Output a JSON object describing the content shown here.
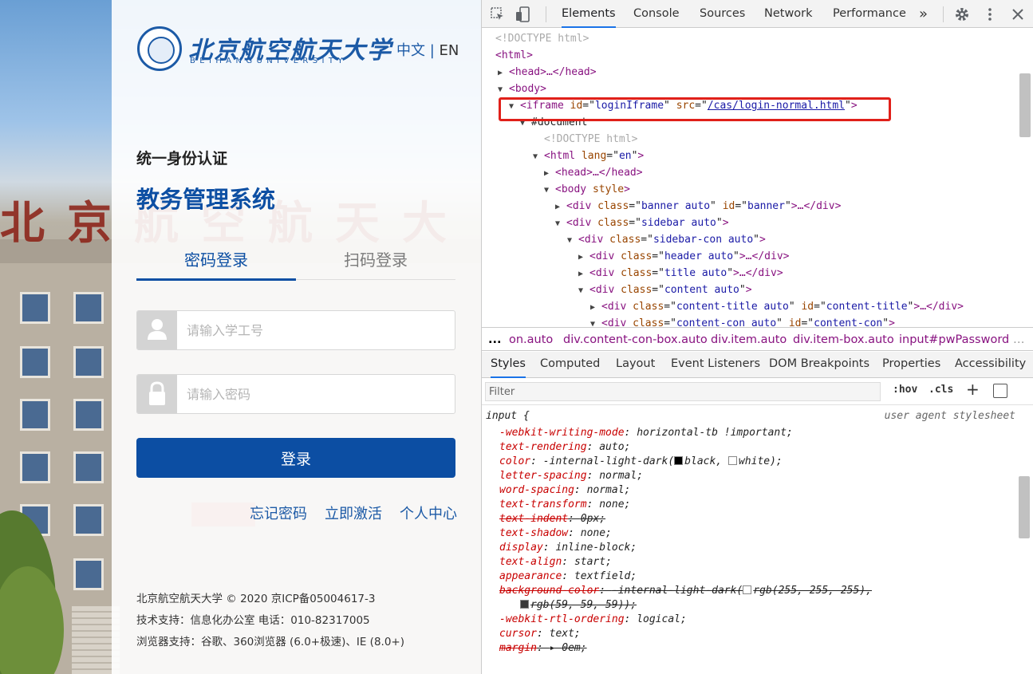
{
  "login": {
    "logo_cn": "北京航空航天大学",
    "logo_en": "BEIHANGUNIVERSITY",
    "lang_cn": "中文",
    "lang_sep": "|",
    "lang_en": "EN",
    "subtitle": "统一身份认证",
    "system_title": "教务管理系统",
    "tabs": [
      "密码登录",
      "扫码登录"
    ],
    "username_placeholder": "请输入学工号",
    "password_placeholder": "请输入密码",
    "login_button": "登录",
    "links": [
      "忘记密码",
      "立即激活",
      "个人中心"
    ],
    "footer": [
      "北京航空航天大学 © 2020 京ICP备05004617-3",
      "技术支持：信息化办公室 电话：010-82317005",
      "浏览器支持：谷歌、360浏览器 (6.0+极速)、IE (8.0+)"
    ],
    "background_sign": "北京航空航天大"
  },
  "devtools": {
    "tabs": [
      "Elements",
      "Console",
      "Sources",
      "Network",
      "Performance",
      "»"
    ],
    "dom": {
      "doctype1": "<!DOCTYPE html>",
      "html_open": "<html>",
      "head_collapsed": "<head>…</head>",
      "body_open": "<body>",
      "iframe": {
        "tag": "iframe",
        "id_attr": "id",
        "id_val": "loginIframe",
        "src_attr": "src",
        "src_val": "/cas/login-normal.html"
      },
      "document": "#document",
      "doctype2": "<!DOCTYPE html>",
      "html_lang": {
        "tag": "html",
        "attr": "lang",
        "val": "en"
      },
      "head2": "<head>…</head>",
      "body_style": {
        "tag": "body",
        "attr": "style"
      },
      "banner": {
        "tag": "div",
        "class": "banner auto",
        "id": "banner"
      },
      "sidebar": {
        "tag": "div",
        "class": "sidebar auto"
      },
      "sidebar_con": {
        "tag": "div",
        "class": "sidebar-con auto"
      },
      "header": {
        "tag": "div",
        "class": "header auto"
      },
      "title": {
        "tag": "div",
        "class": "title auto"
      },
      "content": {
        "tag": "div",
        "class": "content auto"
      },
      "content_title": {
        "tag": "div",
        "class": "content-title auto",
        "id": "content-title"
      },
      "content_con": {
        "tag": "div",
        "class": "content-con auto",
        "id": "content-con"
      }
    },
    "breadcrumbs": [
      "...",
      "on.auto",
      "div.content-con-box.auto",
      "div.item.auto",
      "div.item-box.auto",
      "input#pwPassword",
      "…"
    ],
    "style_tabs": [
      "Styles",
      "Computed",
      "Layout",
      "Event Listeners",
      "DOM Breakpoints",
      "Properties",
      "Accessibility"
    ],
    "filter_placeholder": "Filter",
    "hov": ":hov",
    "cls": ".cls",
    "plus": "+",
    "rule": {
      "selector": "input {",
      "source": "user agent stylesheet",
      "props": [
        {
          "name": "-webkit-writing-mode",
          "value": "horizontal-tb !important;",
          "struck": false
        },
        {
          "name": "text-rendering",
          "value": "auto;",
          "struck": false
        },
        {
          "name": "color",
          "value_pre": "-internal-light-dark(",
          "swatch1": "#000000",
          "mid1": "black, ",
          "swatch2": "#ffffff",
          "mid2": "white);",
          "struck": false
        },
        {
          "name": "letter-spacing",
          "value": "normal;",
          "struck": false
        },
        {
          "name": "word-spacing",
          "value": "normal;",
          "struck": false
        },
        {
          "name": "text-transform",
          "value": "none;",
          "struck": false
        },
        {
          "name": "text-indent",
          "value": "0px;",
          "struck": true
        },
        {
          "name": "text-shadow",
          "value": "none;",
          "struck": false
        },
        {
          "name": "display",
          "value": "inline-block;",
          "struck": false
        },
        {
          "name": "text-align",
          "value": "start;",
          "struck": false
        },
        {
          "name": "appearance",
          "value": "textfield;",
          "struck": false
        },
        {
          "name": "background-color",
          "value_pre": "-internal-light-dark(",
          "swatch1": "#ffffff",
          "mid1": "rgb(255, 255, 255),",
          "swatch2": "#3b3b3b",
          "mid2": "rgb(59, 59, 59));",
          "struck": true
        },
        {
          "name": "-webkit-rtl-ordering",
          "value": "logical;",
          "struck": false
        },
        {
          "name": "cursor",
          "value": "text;",
          "struck": false
        },
        {
          "name": "margin",
          "value": "0em;",
          "struck": true
        }
      ]
    }
  },
  "colors": {
    "brand_blue": "#0c4ea3",
    "highlight_red": "#e0201a",
    "devtools_active": "#1a73e8"
  }
}
